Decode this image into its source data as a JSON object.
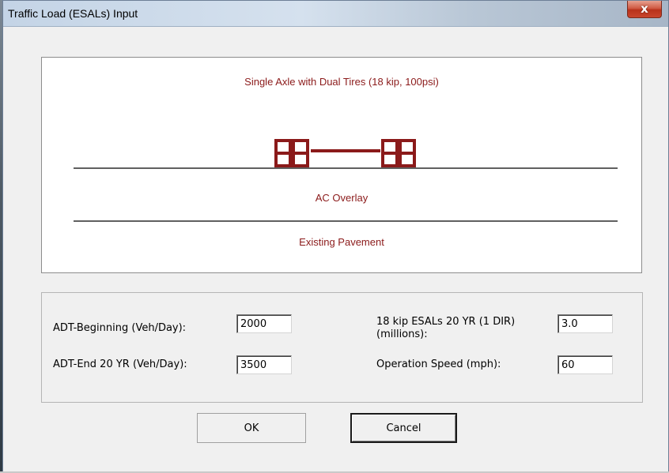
{
  "window": {
    "title": "Traffic Load (ESALs) Input",
    "close_label": "x"
  },
  "diagram": {
    "axle_title": "Single Axle with Dual Tires (18 kip, 100psi)",
    "layer_overlay": "AC Overlay",
    "layer_existing": "Existing Pavement",
    "line_color": "#000000",
    "axle_color": "#8b1a1a"
  },
  "inputs": {
    "adt_beginning": {
      "label": "ADT-Beginning (Veh/Day):",
      "value": "2000"
    },
    "adt_end": {
      "label": "ADT-End 20 YR (Veh/Day):",
      "value": "3500"
    },
    "esals": {
      "label_line1": "18 kip ESALs 20 YR (1 DIR)",
      "label_line2": "(millions):",
      "value": "3.0"
    },
    "speed": {
      "label": "Operation Speed (mph):",
      "value": "60"
    }
  },
  "buttons": {
    "ok": "OK",
    "cancel": "Cancel"
  }
}
